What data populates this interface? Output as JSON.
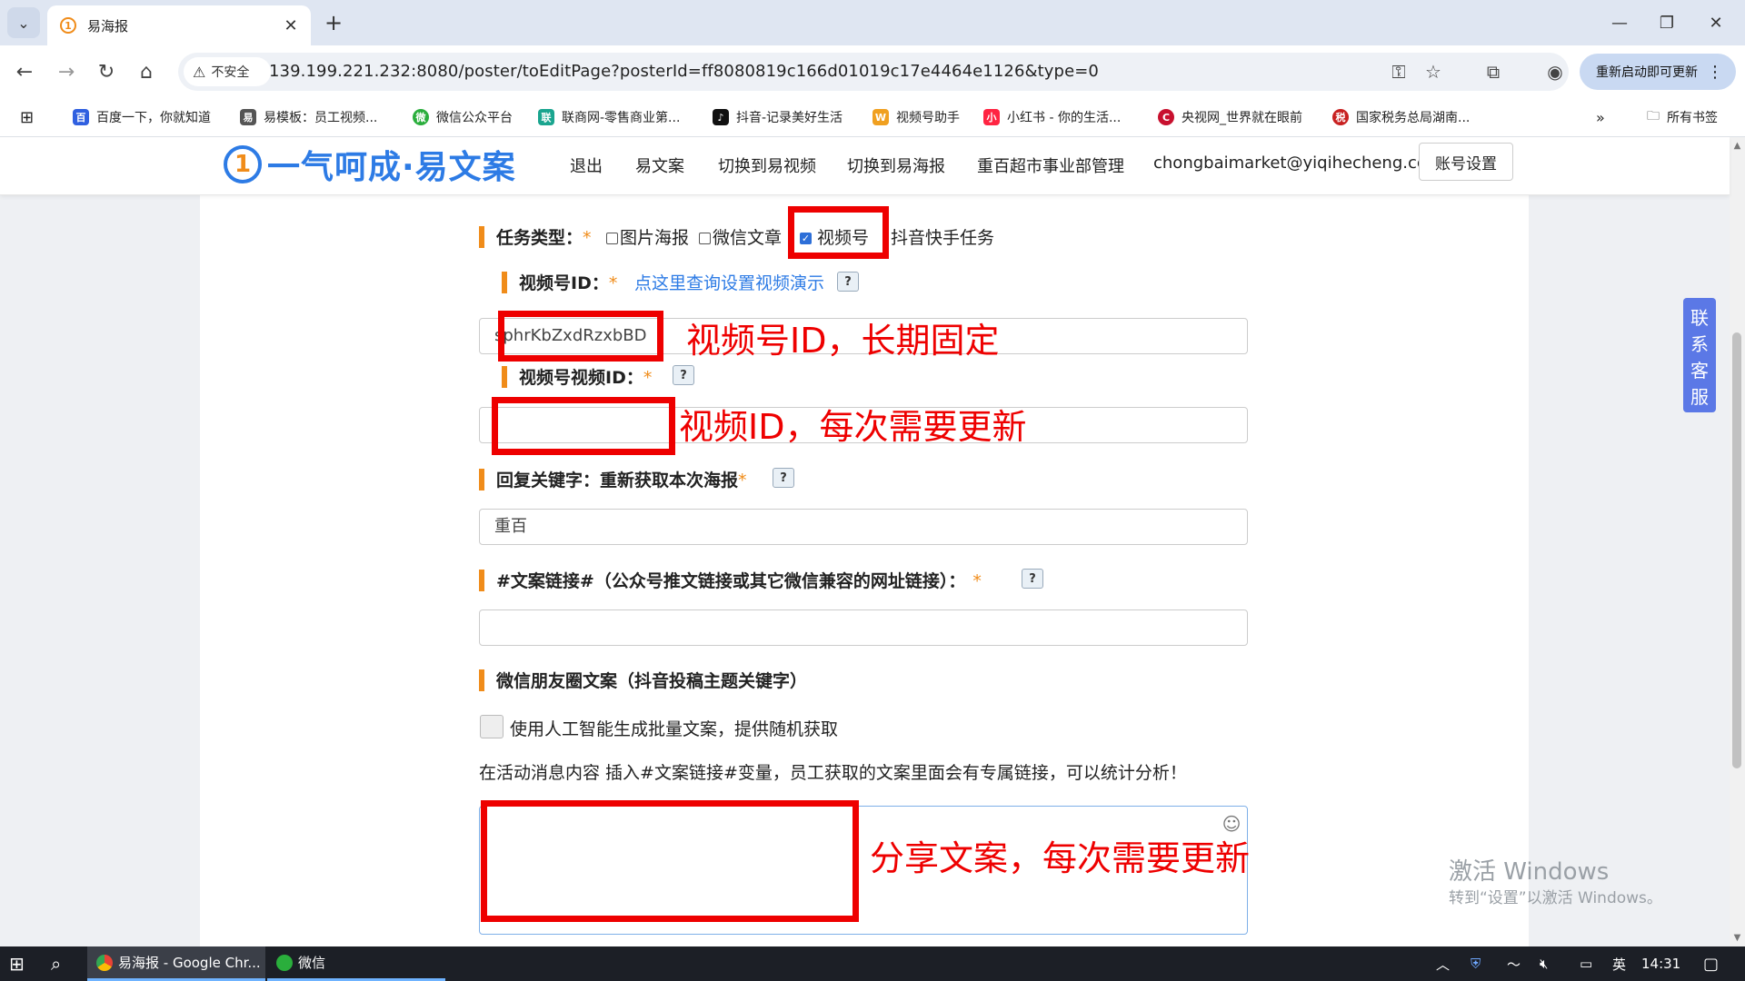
{
  "browser": {
    "tab_title": "易海报",
    "tab_favicon_text": "1",
    "new_tab_label": "+",
    "security_chip": "不安全",
    "url": "139.199.221.232:8080/poster/toEditPage?posterId=ff8080819c166d01019c17e4464e1126&type=0",
    "update_button": "重新启动即可更新",
    "bookmarks": [
      "百度一下，你就知道",
      "易模板：员工视频...",
      "微信公众平台",
      "联商网-零售商业第...",
      "抖音-记录美好生活",
      "视频号助手",
      "小红书 - 你的生活...",
      "央视网_世界就在眼前",
      "国家税务总局湖南..."
    ],
    "bookmarks_more": "»",
    "all_bookmarks": "所有书签"
  },
  "site": {
    "logo_mark": "1",
    "logo_text": "一气呵成·易文案",
    "nav": [
      "退出",
      "易文案",
      "切换到易视频",
      "切换到易海报",
      "重百超市事业部管理",
      "chongbaimarket@yiqihecheng.cc"
    ],
    "account_button": "账号设置"
  },
  "form": {
    "task_type_label": "任务类型：",
    "required_mark": "*",
    "task_options": [
      {
        "label": "图片海报",
        "checked": false
      },
      {
        "label": "微信文章",
        "checked": false
      },
      {
        "label": "视频号",
        "checked": true
      },
      {
        "label": "抖音快手任务",
        "checked": false
      }
    ],
    "channel_id_label": "视频号ID：",
    "channel_id_link": "点这里查询设置视频演示",
    "channel_id_value": "sphrKbZxdRzxbBD",
    "video_id_label": "视频号视频ID：",
    "video_id_value": "",
    "reply_label": "回复关键字：重新获取本次海报",
    "reply_value": "重百",
    "link_label": "#文案链接#（公众号推文链接或其它微信兼容的网址链接）：",
    "link_value": "",
    "moments_label": "微信朋友圈文案（抖音投稿主题关键字）",
    "ai_checkbox_label": "使用人工智能生成批量文案，提供随机获取",
    "hint_text": "在活动消息内容 插入#文案链接#变量，员工获取的文案里面会有专属链接，可以统计分析！",
    "help_icon": "?",
    "emoji_icon": "☺"
  },
  "annotations": {
    "channel_id_note": "视频号ID，长期固定",
    "video_id_note": "视频ID，每次需要更新",
    "share_text_note": "分享文案，每次需要更新"
  },
  "floating": {
    "customer_service": [
      "联",
      "系",
      "客",
      "服"
    ]
  },
  "watermark": {
    "line1": "激活 Windows",
    "line2": "转到“设置”以激活 Windows。"
  },
  "taskbar": {
    "apps": [
      {
        "label": "易海报 - Google Chr...",
        "active": true
      },
      {
        "label": "微信",
        "active": false
      }
    ],
    "ime": "英",
    "time": "14:31"
  },
  "colors": {
    "brand_blue": "#2d7be5",
    "accent_orange": "#f08c1a",
    "annotation_red": "#ee0000",
    "service_button": "#5b78e6"
  }
}
